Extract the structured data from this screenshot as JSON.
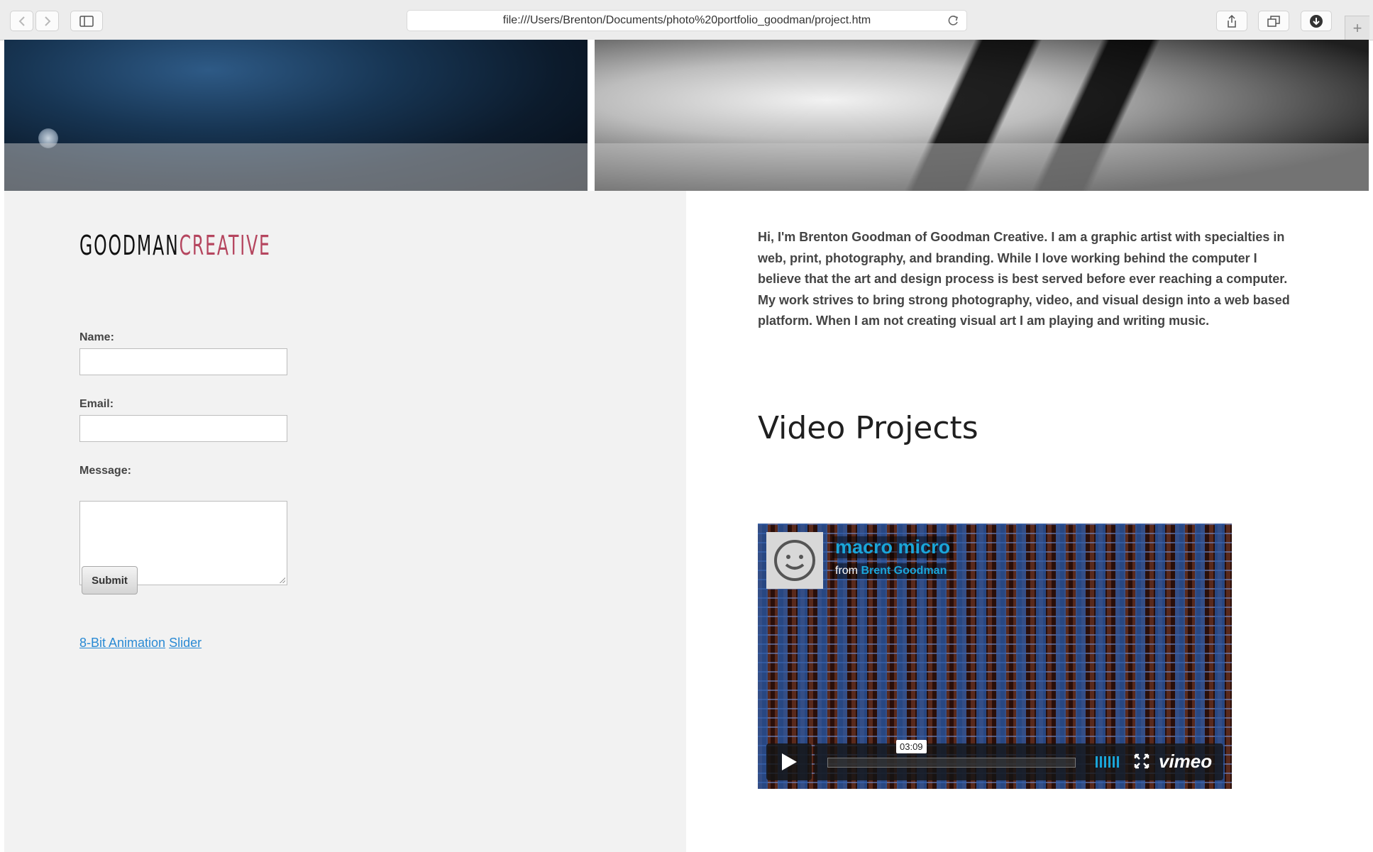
{
  "browser": {
    "url": "file:///Users/Brenton/Documents/photo%20portfolio_goodman/project.htm",
    "new_tab_glyph": "+"
  },
  "logo": {
    "part1": "GOODMAN",
    "part2": "CREATIVE"
  },
  "form": {
    "name_label": "Name:",
    "email_label": "Email:",
    "message_label": "Message:",
    "submit_label": "Submit"
  },
  "links": {
    "animation": "8-Bit Animation",
    "slider": "Slider"
  },
  "about": "Hi, I'm Brenton Goodman of Goodman Creative. I am a graphic artist with specialties in web, print, photography, and branding. While I love working behind the computer I believe that the art and design process is best served before ever reaching a computer. My work strives to bring strong photography, video, and visual design into a web based platform. When I am not creating visual art I am playing and writing music.",
  "video_section": {
    "heading": "Video Projects",
    "title": "macro micro",
    "from": "from",
    "author": "Brent Goodman",
    "duration": "03:09",
    "brand": "vimeo"
  },
  "colors": {
    "link": "#2a8ad4",
    "vimeo_accent": "#1aa5d8",
    "logo_accent": "#b5465f",
    "panel_bg": "#f2f2f2"
  }
}
